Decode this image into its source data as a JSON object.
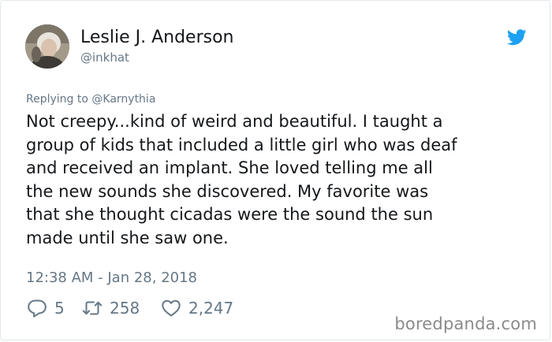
{
  "author": {
    "name": "Leslie J. Anderson",
    "handle": "@inkhat"
  },
  "reply_context": {
    "prefix": "Replying to ",
    "mention": "@Karnythia"
  },
  "tweet": {
    "text": "Not creepy...kind of weird and beautiful. I taught a\ngroup of kids that included a little girl who was deaf\nand received an implant. She loved telling me all\nthe new sounds she discovered. My favorite was\nthat she thought cicadas were the sound the sun\nmade until she saw one.",
    "timestamp": "12:38 AM - Jan 28, 2018"
  },
  "actions": {
    "replies": "5",
    "retweets": "258",
    "likes": "2,247"
  },
  "icons": {
    "reply": "reply-icon",
    "retweet": "retweet-icon",
    "like": "heart-icon",
    "platform": "twitter-bird-icon"
  },
  "colors": {
    "brand": "#1da1f2",
    "secondary_text": "#657786",
    "primary_text": "#14171a"
  },
  "watermark": "boredpanda.com"
}
